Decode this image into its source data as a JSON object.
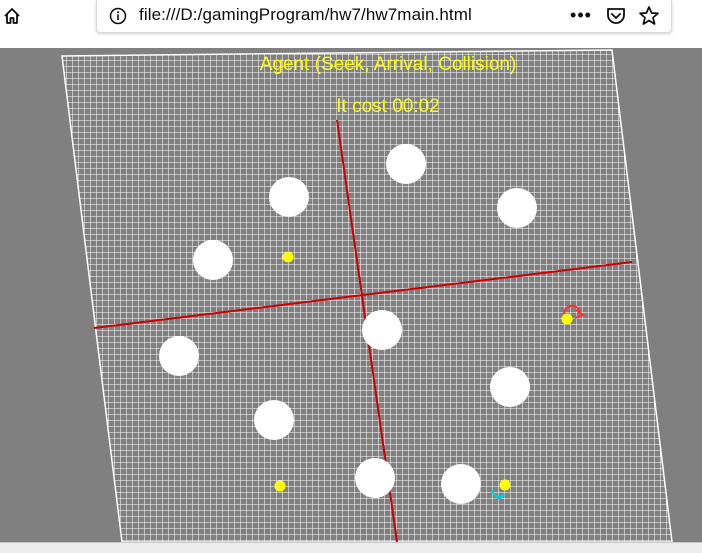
{
  "browser": {
    "url": "file:///D:/gamingProgram/hw7/hw7main.html",
    "more_label": "•••",
    "icons": {
      "home": "home-icon",
      "info": "info-icon",
      "pocket": "pocket-icon",
      "star": "star-icon"
    }
  },
  "scene": {
    "title": "Agent (Seek, Arrival, Collision)",
    "timer": "It cost 00:02",
    "colors": {
      "background": "#808080",
      "grid": "#ffffff",
      "axis": "#cc0000",
      "text": "#ffff00",
      "obstacle": "#ffffff",
      "agent": "#ffff00",
      "heading_red": "#ff3030",
      "heading_cyan": "#00ccdd"
    }
  }
}
